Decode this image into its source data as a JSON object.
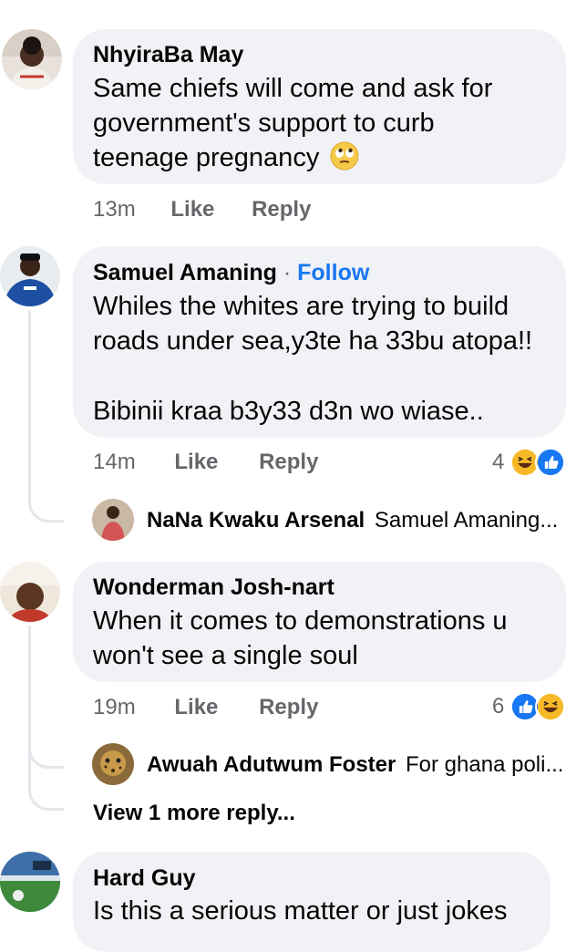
{
  "comments": [
    {
      "name": "NhyiraBa May",
      "lines": [
        "Same chiefs will come and ask for",
        "government's support to curb",
        "teenage pregnancy"
      ],
      "emoji": "eye-roll-emoji",
      "time": "13m",
      "like": "Like",
      "reply": "Reply"
    },
    {
      "name": "Samuel Amaning",
      "follow": "Follow",
      "separator": "·",
      "lines": [
        "Whiles the whites are trying to build",
        "roads under sea,y3te ha 33bu atopa!!",
        "",
        "Bibinii kraa b3y33 d3n wo wiase.."
      ],
      "time": "14m",
      "like": "Like",
      "reply": "Reply",
      "reaction_count": "4",
      "reply_preview": {
        "name": "NaNa Kwaku Arsenal",
        "text": "Samuel Amaning..."
      }
    },
    {
      "name": "Wonderman Josh-nart",
      "lines": [
        "When it comes to demonstrations u",
        "won't see a single soul"
      ],
      "time": "19m",
      "like": "Like",
      "reply": "Reply",
      "reaction_count": "6",
      "reply_preview": {
        "name": "Awuah Adutwum Foster",
        "text": "For ghana poli..."
      },
      "more_replies": "View 1 more reply..."
    },
    {
      "name": "Hard Guy",
      "lines": [
        "Is this a serious matter or just jokes"
      ]
    }
  ],
  "colors": {
    "bubble": "#f0f2f5",
    "meta": "#65676b",
    "follow": "#1877f2",
    "like_blue": "#1877f2",
    "haha_yellow": "#f7b928"
  }
}
